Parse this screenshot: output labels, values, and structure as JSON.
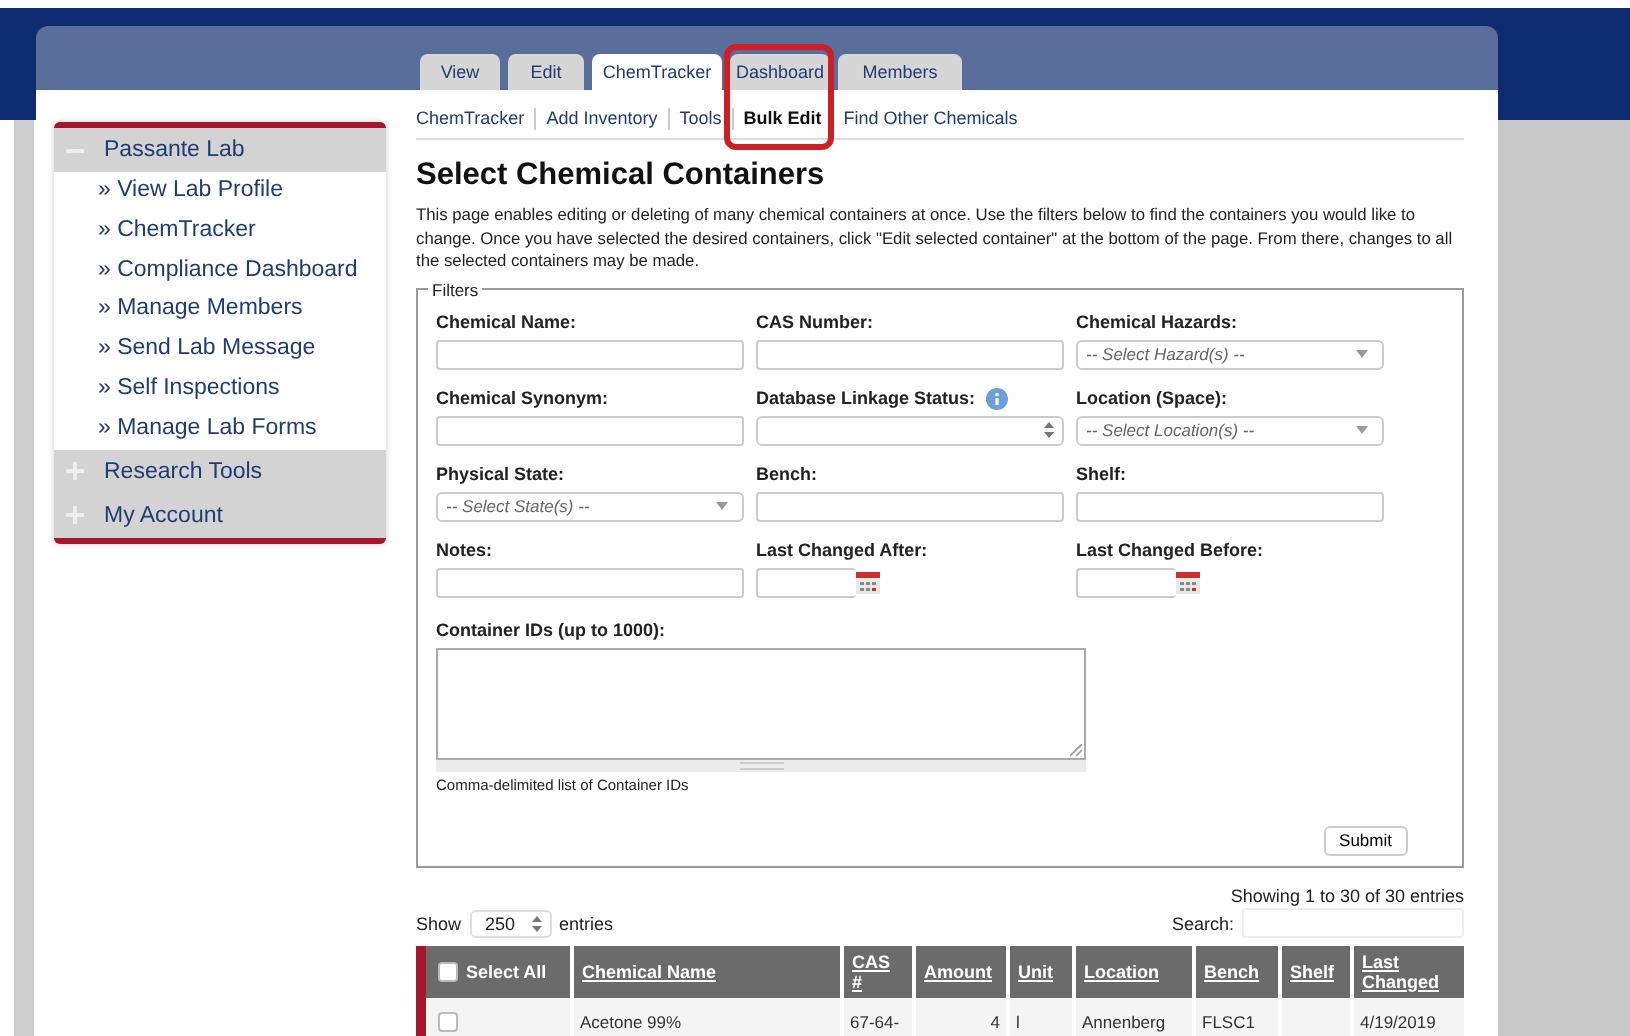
{
  "header_tabs": [
    {
      "label": "View",
      "selected": false
    },
    {
      "label": "Edit",
      "selected": false
    },
    {
      "label": "ChemTracker",
      "selected": true
    },
    {
      "label": "Dashboard",
      "selected": false
    },
    {
      "label": "Members",
      "selected": false
    }
  ],
  "subnav": [
    {
      "label": "ChemTracker",
      "selected": false,
      "highlighted": false
    },
    {
      "label": "Add Inventory",
      "selected": false,
      "highlighted": false
    },
    {
      "label": "Tools",
      "selected": false,
      "highlighted": false
    },
    {
      "label": "Bulk Edit",
      "selected": true,
      "highlighted": true
    },
    {
      "label": "Find Other Chemicals",
      "selected": false,
      "highlighted": false
    }
  ],
  "sidebar": {
    "groups": [
      {
        "label": "Passante Lab",
        "expanded": true,
        "children": [
          {
            "label": "» View Lab Profile"
          },
          {
            "label": "» ChemTracker"
          },
          {
            "label": "» Compliance Dashboard"
          },
          {
            "label": "» Manage Members"
          },
          {
            "label": "» Send Lab Message"
          },
          {
            "label": "» Self Inspections"
          },
          {
            "label": "» Manage Lab Forms"
          }
        ]
      },
      {
        "label": "Research Tools",
        "expanded": false
      },
      {
        "label": "My Account",
        "expanded": false
      }
    ]
  },
  "page": {
    "title": "Select Chemical Containers",
    "intro": "This page enables editing or deleting of many chemical containers at once. Use the filters below to find the containers you would like to change. Once you have selected the desired containers, click \"Edit selected container\" at the bottom of the page. From there, changes to all the selected containers may be made."
  },
  "filters": {
    "legend": "Filters",
    "fields": [
      {
        "kind": "text",
        "label": "Chemical Name:"
      },
      {
        "kind": "text",
        "label": "CAS Number:"
      },
      {
        "kind": "select",
        "label": "Chemical Hazards:",
        "placeholder": "-- Select Hazard(s) --"
      },
      {
        "kind": "text",
        "label": "Chemical Synonym:"
      },
      {
        "kind": "spinner",
        "label": "Database Linkage Status:",
        "info": true
      },
      {
        "kind": "select",
        "label": "Location (Space):",
        "placeholder": "-- Select Location(s) --"
      },
      {
        "kind": "select",
        "label": "Physical State:",
        "placeholder": "-- Select State(s) --"
      },
      {
        "kind": "text",
        "label": "Bench:"
      },
      {
        "kind": "text",
        "label": "Shelf:"
      },
      {
        "kind": "text",
        "label": "Notes:"
      },
      {
        "kind": "date",
        "label": "Last Changed After:"
      },
      {
        "kind": "date",
        "label": "Last Changed Before:"
      }
    ],
    "container_ids": {
      "label": "Container IDs (up to 1000):",
      "hint": "Comma-delimited list of Container IDs"
    },
    "submit": "Submit"
  },
  "table": {
    "info": "Showing 1 to 30 of 30 entries",
    "length": {
      "before": "Show",
      "value": "250",
      "after": "entries"
    },
    "search_label": "Search:",
    "select_all": {
      "label": "Select All",
      "checked": false
    },
    "columns": [
      "Chemical Name",
      "CAS #",
      "Amount",
      "Unit",
      "Location",
      "Bench",
      "Shelf",
      "Last Changed"
    ],
    "rows": [
      {
        "checked": false,
        "cells": [
          "Acetone 99%",
          "67-64-",
          "4",
          "l",
          "Annenberg",
          "FLSC1",
          null,
          "4/19/2019"
        ]
      }
    ]
  }
}
